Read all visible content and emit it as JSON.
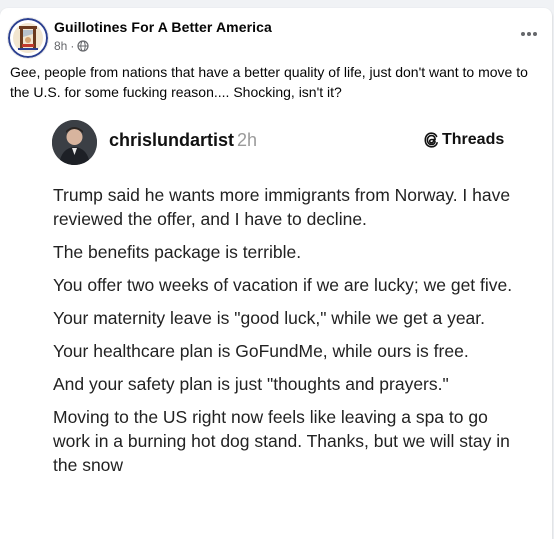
{
  "post": {
    "group_name": "Guillotines For A Better America",
    "time": "8h",
    "separator": "·",
    "privacy_icon": "globe-icon",
    "more_icon": "more-options-icon",
    "caption": "Gee, people from nations that have a better quality of life, just don't want to move to the U.S. for some fucking reason.... Shocking, isn't it?"
  },
  "threads_post": {
    "username": "chrislundartist",
    "time": "2h",
    "brand": "Threads",
    "brand_icon": "threads-logo-icon",
    "paragraphs": [
      "Trump said he wants more immigrants from Norway. I have reviewed the offer, and I have to decline.",
      "The benefits package is terrible.",
      "You offer two weeks of vacation if we are lucky; we get five.",
      "Your maternity leave is \"good luck,\" while we get a year.",
      "Your healthcare plan is GoFundMe, while ours is free.",
      "And your safety plan is just \"thoughts and prayers.\"",
      "Moving to the US right now feels like leaving a spa to go work in a burning hot dog stand. Thanks, but we will stay in the snow"
    ]
  },
  "colors": {
    "page_bg": "#f0f2f5",
    "card_bg": "#ffffff",
    "primary_text": "#050505",
    "secondary_text": "#65676b"
  }
}
